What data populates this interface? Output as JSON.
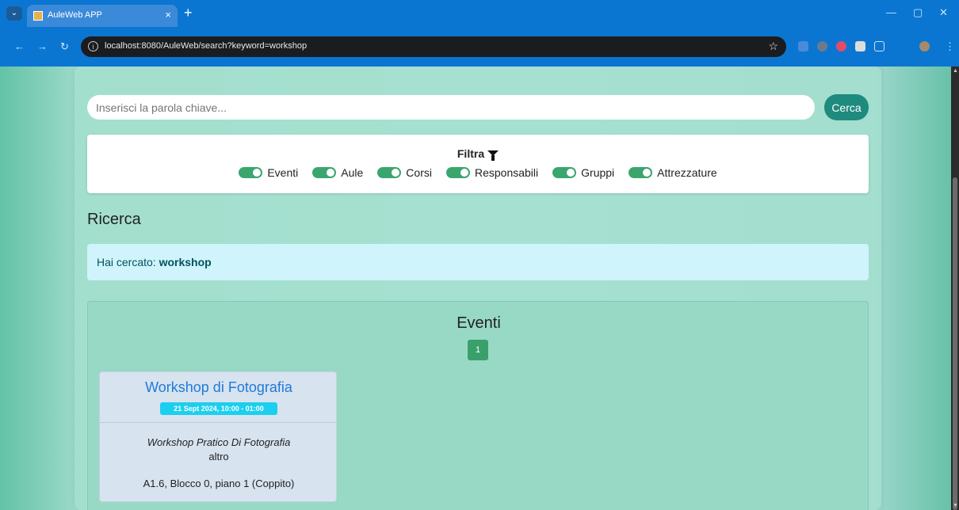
{
  "browser": {
    "tab_title": "AuleWeb APP",
    "tab_close": "×",
    "new_tab": "+",
    "url": "localhost:8080/AuleWeb/search?keyword=workshop"
  },
  "search": {
    "placeholder": "Inserisci la parola chiave...",
    "button_label": "Cerca"
  },
  "filter": {
    "title": "Filtra",
    "toggles": [
      {
        "label": "Eventi",
        "on": true
      },
      {
        "label": "Aule",
        "on": true
      },
      {
        "label": "Corsi",
        "on": true
      },
      {
        "label": "Responsabili",
        "on": true
      },
      {
        "label": "Gruppi",
        "on": true
      },
      {
        "label": "Attrezzature",
        "on": true
      }
    ]
  },
  "main": {
    "heading": "Ricerca",
    "alert_prefix": "Hai cercato: ",
    "alert_keyword": "workshop"
  },
  "events": {
    "title": "Eventi",
    "page": "1",
    "items": [
      {
        "title": "Workshop di Fotografia",
        "date": "21 Sept 2024, 10:00 - 01:00",
        "subtitle": "Workshop Pratico Di Fotografia",
        "type": "altro",
        "location": "A1.6, Blocco 0, piano 1 (Coppito)"
      }
    ]
  },
  "colors": {
    "accent": "#1f8a7e",
    "toggle_on": "#3aa66e",
    "event_title": "#1f7ad8",
    "date_badge": "#1ccfef"
  }
}
